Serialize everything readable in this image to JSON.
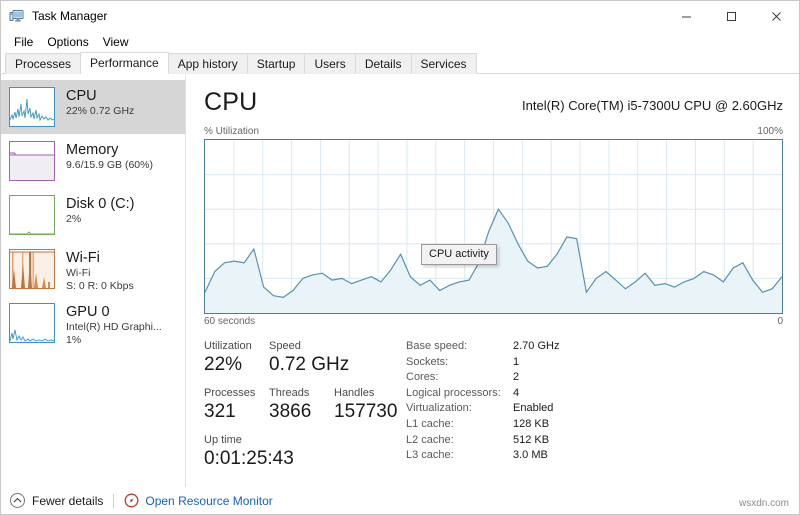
{
  "window": {
    "title": "Task Manager",
    "icon": "task-manager-icon",
    "controls": {
      "minimize": "–",
      "maximize": "□",
      "close": "✕"
    }
  },
  "menubar": {
    "items": [
      "File",
      "Options",
      "View"
    ]
  },
  "tabs": {
    "items": [
      "Processes",
      "Performance",
      "App history",
      "Startup",
      "Users",
      "Details",
      "Services"
    ],
    "active": "Performance"
  },
  "sidebar": {
    "items": [
      {
        "title": "CPU",
        "sub1": "22% 0.72 GHz",
        "sub2": "",
        "color": "#3a94c5",
        "selected": true,
        "thumb": "cpu-thumbnail"
      },
      {
        "title": "Memory",
        "sub1": "9.6/15.9 GB (60%)",
        "sub2": "",
        "color": "#a661b0",
        "selected": false,
        "thumb": "memory-thumbnail"
      },
      {
        "title": "Disk 0 (C:)",
        "sub1": "2%",
        "sub2": "",
        "color": "#73ab5a",
        "selected": false,
        "thumb": "disk-thumbnail"
      },
      {
        "title": "Wi-Fi",
        "sub1": "Wi-Fi",
        "sub2": "S: 0 R: 0 Kbps",
        "color": "#c07540",
        "selected": false,
        "thumb": "wifi-thumbnail"
      },
      {
        "title": "GPU 0",
        "sub1": "Intel(R) HD Graphi...",
        "sub2": "1%",
        "color": "#3a94c5",
        "selected": false,
        "thumb": "gpu-thumbnail"
      }
    ]
  },
  "main": {
    "title": "CPU",
    "cpu_name": "Intel(R) Core(TM) i5-7300U CPU @ 2.60GHz",
    "graph_top_left": "% Utilization",
    "graph_top_right": "100%",
    "graph_bottom_left": "60 seconds",
    "graph_bottom_right": "0",
    "tooltip": "CPU activity",
    "line_color": "#5491ad",
    "fill_color": "#eaf3f8",
    "grid_color": "#d9e8f0",
    "border_color": "#4b7f97"
  },
  "stats": {
    "left": [
      [
        {
          "label": "Utilization",
          "value": "22%"
        },
        {
          "label": "Speed",
          "value": "0.72 GHz"
        }
      ],
      [
        {
          "label": "Processes",
          "value": "321"
        },
        {
          "label": "Threads",
          "value": "3866"
        },
        {
          "label": "Handles",
          "value": "157730"
        }
      ],
      [
        {
          "label": "Up time",
          "value": "0:01:25:43"
        }
      ]
    ],
    "right": [
      {
        "label": "Base speed:",
        "value": "2.70 GHz"
      },
      {
        "label": "Sockets:",
        "value": "1"
      },
      {
        "label": "Cores:",
        "value": "2"
      },
      {
        "label": "Logical processors:",
        "value": "4"
      },
      {
        "label": "Virtualization:",
        "value": "Enabled"
      },
      {
        "label": "L1 cache:",
        "value": "128 KB"
      },
      {
        "label": "L2 cache:",
        "value": "512 KB"
      },
      {
        "label": "L3 cache:",
        "value": "3.0 MB"
      }
    ]
  },
  "statusbar": {
    "fewer_details": "Fewer details",
    "fewer_details_icon": "chevron-up-icon",
    "resource_monitor": "Open Resource Monitor",
    "resource_monitor_icon": "resource-monitor-icon"
  },
  "watermark": "wsxdn.com",
  "chart_data": {
    "type": "area",
    "title": "CPU activity",
    "xlabel": "60 seconds",
    "ylabel": "% Utilization",
    "ylim": [
      0,
      100
    ],
    "xlim": [
      60,
      0
    ],
    "grid": true,
    "x": [
      0,
      1,
      2,
      3,
      4,
      5,
      6,
      7,
      8,
      9,
      10,
      11,
      12,
      13,
      14,
      15,
      16,
      17,
      18,
      19,
      20,
      21,
      22,
      23,
      24,
      25,
      26,
      27,
      28,
      29,
      30,
      31,
      32,
      33,
      34,
      35,
      36,
      37,
      38,
      39,
      40,
      41,
      42,
      43,
      44,
      45,
      46,
      47,
      48,
      49,
      50,
      51,
      52,
      53,
      54,
      55,
      56,
      57,
      58,
      59
    ],
    "values": [
      12,
      24,
      29,
      30,
      29,
      37,
      15,
      10,
      9,
      13,
      20,
      22,
      23,
      19,
      20,
      17,
      19,
      21,
      18,
      25,
      34,
      21,
      16,
      19,
      13,
      16,
      18,
      19,
      29,
      47,
      60,
      52,
      40,
      30,
      26,
      27,
      34,
      44,
      43,
      12,
      20,
      24,
      19,
      14,
      18,
      23,
      16,
      17,
      15,
      18,
      20,
      24,
      22,
      18,
      26,
      29,
      19,
      12,
      14,
      21
    ]
  }
}
